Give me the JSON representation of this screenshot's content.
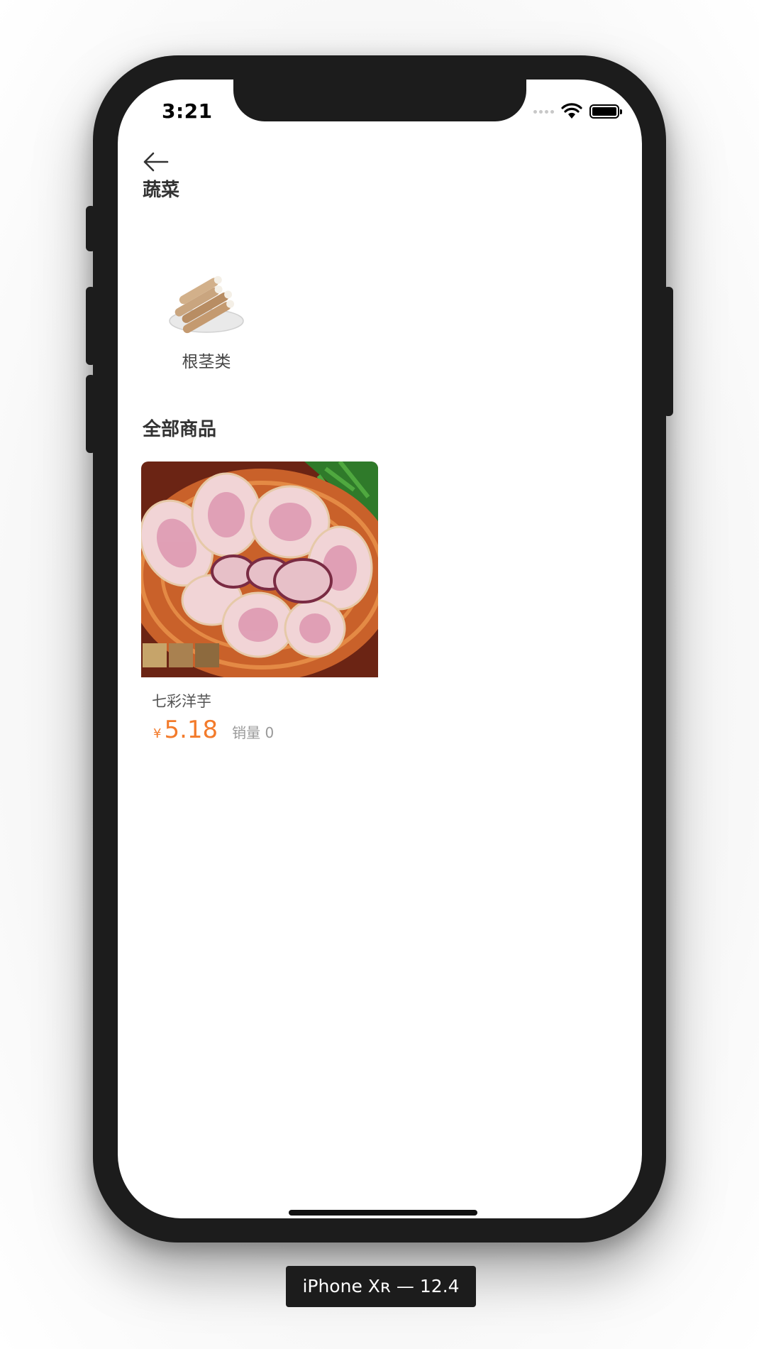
{
  "status_bar": {
    "time": "3:21"
  },
  "nav": {
    "back_icon": "arrow-left-icon"
  },
  "category_section": {
    "title": "蔬菜",
    "items": [
      {
        "label": "根茎类",
        "icon": "yam-image"
      }
    ]
  },
  "products_section": {
    "title": "全部商品",
    "products": [
      {
        "name": "七彩洋芋",
        "currency": "¥",
        "price": "5.18",
        "sales": "销量 0"
      }
    ]
  },
  "device_label": "iPhone Xʀ — 12.4",
  "colors": {
    "price": "#f37b2b",
    "frame": "#1c1c1c"
  }
}
